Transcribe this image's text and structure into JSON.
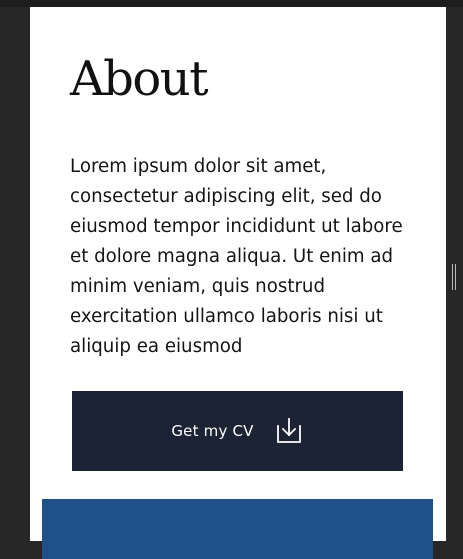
{
  "about": {
    "title": "About",
    "body": "Lorem ipsum dolor sit amet, consectetur adipiscing elit, sed do eiusmod tempor incididunt ut labore et dolore magna aliqua. Ut enim ad minim veniam, quis nostrud exercitation ullamco laboris nisi ut aliquip ea eiusmod",
    "cv_button": {
      "label": "Get my CV",
      "icon": "download-icon"
    }
  },
  "colors": {
    "page_background": "#272727",
    "panel_background": "#ffffff",
    "button_background": "#1b2335",
    "accent_block": "#20508a"
  }
}
